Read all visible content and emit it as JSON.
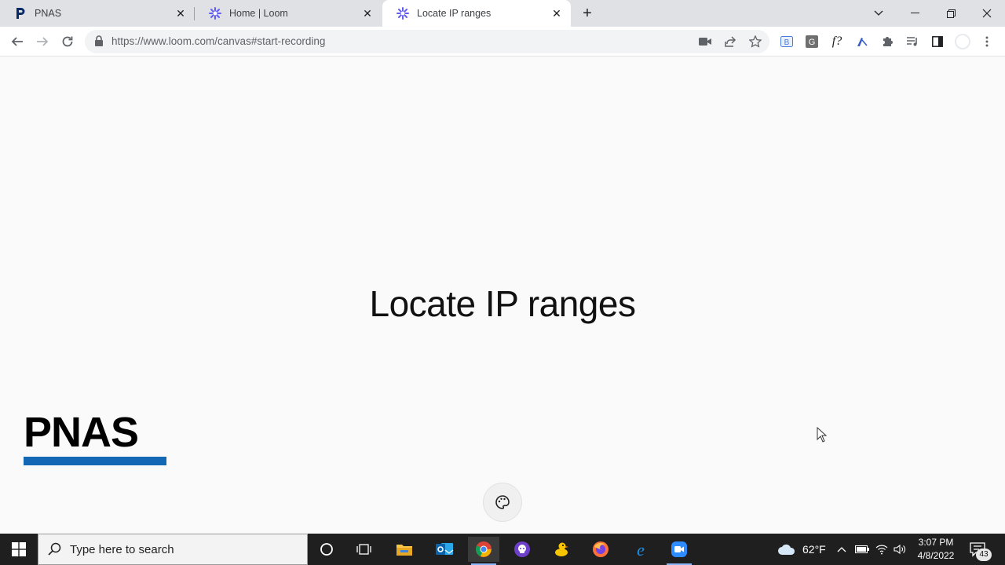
{
  "browser": {
    "tabs": [
      {
        "title": "PNAS",
        "favicon": "pnas-p-icon"
      },
      {
        "title": "Home | Loom",
        "favicon": "loom-icon"
      },
      {
        "title": "Locate IP ranges",
        "favicon": "loom-icon",
        "active": true
      }
    ],
    "url": "https://www.loom.com/canvas#start-recording",
    "extensions": [
      "camera-icon",
      "share-icon",
      "star-icon",
      "b-extension-icon",
      "g-extension-icon",
      "f-question-icon",
      "pen-icon",
      "puzzle-icon",
      "media-icon",
      "sidebar-icon",
      "profile-icon",
      "menu-icon"
    ]
  },
  "page": {
    "headline": "Locate IP ranges",
    "logo_text": "PNAS",
    "logo_bar_color": "#1467b5"
  },
  "taskbar": {
    "search_placeholder": "Type here to search",
    "apps": [
      "cortana-icon",
      "task-view-icon",
      "file-explorer-icon",
      "outlook-icon",
      "chrome-icon",
      "github-icon",
      "duck-icon",
      "firefox-icon",
      "edge-icon",
      "zoom-icon"
    ],
    "weather": "62°F",
    "time": "3:07 PM",
    "date": "4/8/2022",
    "notification_count": "43"
  }
}
